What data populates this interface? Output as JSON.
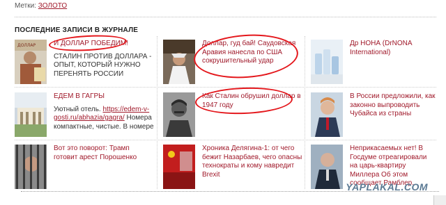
{
  "tags": {
    "label": "Метки:",
    "value": "ЗОЛОТО"
  },
  "section_title": "ПОСЛЕДНИЕ ЗАПИСИ В ЖУРНАЛЕ",
  "items": [
    {
      "title": "И ДОЛЛАР ПОБЕДИМ!",
      "desc": "СТАЛИН ПРОТИВ ДОЛЛАРА - ОПЫТ, КОТОРЫЙ НУЖНО ПЕРЕНЯТЬ РОССИИ"
    },
    {
      "title": "Доллар, гуд бай! Саудовская Аравия нанесла по США сокрушительный удар",
      "desc": ""
    },
    {
      "title": "Др НОНА (DrNONA International)",
      "desc": ""
    },
    {
      "title": "ЕДЕМ В ГАГРЫ",
      "desc_prefix": "Уютный отель. ",
      "desc_link": "https://edem-v-gosti.ru/abhazia/gagra/",
      "desc_suffix": " Номера компактные, чистые. В номере"
    },
    {
      "title": "Как Сталин обрушил доллар в 1947 году",
      "desc": ""
    },
    {
      "title": "В России предложили, как законно выпроводить Чубайса из страны",
      "desc": ""
    },
    {
      "title": "Вот это поворот: Трамп готовит арест Порошенко",
      "desc": ""
    },
    {
      "title": "Хроника Делягина-1: от чего бежит Назарбаев, чего опасны технократы и кому навредит Brexit",
      "desc": ""
    },
    {
      "title": "Неприкасаемых нет! В Госдуме отреагировали на царь-квартиру Миллера  Об этом сообщает Рамблер.",
      "desc": ""
    }
  ],
  "watermark": "YAPLAKAL.COM",
  "colors": {
    "link": "#a0192a",
    "ink": "#e4171c",
    "watermark": "#5b7a94"
  }
}
